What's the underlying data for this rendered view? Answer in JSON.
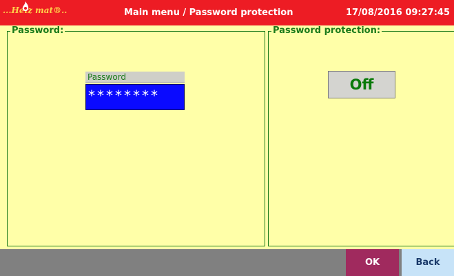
{
  "header": {
    "logo_text": "...Heiz mat®..",
    "title": "Main menu / Password protection",
    "datetime": "17/08/2016 09:27:45"
  },
  "password_panel": {
    "title": "Password:",
    "field_label": "Password",
    "field_value": "********"
  },
  "protection_panel": {
    "title": "Password protection:",
    "toggle_label": "Off"
  },
  "footer": {
    "ok_label": "OK",
    "back_label": "Back"
  },
  "colors": {
    "title_bar": "#ed1c24",
    "background": "#ffffa8",
    "password_field": "#0a0aff",
    "ok_button": "#a02a5e",
    "back_button": "#c7e3f8"
  },
  "icons": {
    "logo_flame": "flame-icon"
  }
}
